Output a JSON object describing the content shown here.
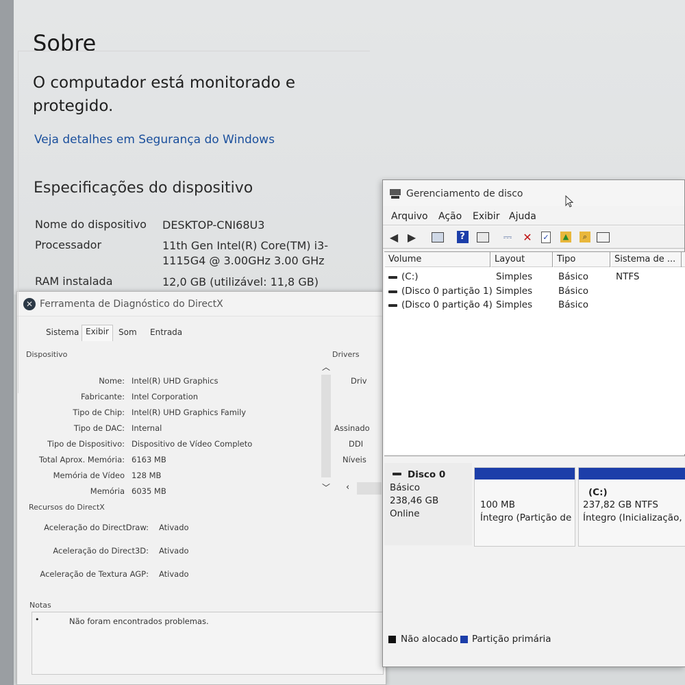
{
  "settings": {
    "title": "Sobre",
    "status": "O computador está monitorado e protegido.",
    "security_link": "Veja detalhes em Segurança do Windows",
    "specs_title": "Especificações do dispositivo",
    "rows": [
      {
        "label": "Nome do dispositivo",
        "value": "DESKTOP-CNI68U3"
      },
      {
        "label": "Processador",
        "value": "11th Gen Intel(R) Core(TM) i3-1115G4 @ 3.00GHz   3.00 GHz"
      },
      {
        "label": "RAM instalada",
        "value": "12,0 GB (utilizável: 11,8 GB)"
      }
    ]
  },
  "directx": {
    "title": "Ferramenta de Diagnóstico do DirectX",
    "tabs": [
      "Sistema",
      "Exibir",
      "Som",
      "Entrada"
    ],
    "active_tab": "Exibir",
    "device_group": "Dispositivo",
    "drivers_group": "Drivers",
    "device_rows": [
      {
        "label": "Nome:",
        "value": "Intel(R) UHD Graphics"
      },
      {
        "label": "Fabricante:",
        "value": "Intel Corporation"
      },
      {
        "label": "Tipo de Chip:",
        "value": "Intel(R) UHD Graphics Family"
      },
      {
        "label": "Tipo de DAC:",
        "value": "Internal"
      },
      {
        "label": "Tipo de Dispositivo:",
        "value": "Dispositivo de Vídeo Completo"
      },
      {
        "label": "Total Aprox. Memória:",
        "value": "6163 MB"
      },
      {
        "label": "Memória de Vídeo",
        "value": "128 MB"
      },
      {
        "label": "Memória",
        "value": "6035 MB"
      }
    ],
    "drivers_partial": [
      "Driv",
      "Assinado",
      "DDI",
      "Níveis"
    ],
    "resources_group": "Recursos do DirectX",
    "resources": [
      {
        "label": "Aceleração do DirectDraw:",
        "value": "Ativado"
      },
      {
        "label": "Aceleração do Direct3D:",
        "value": "Ativado"
      },
      {
        "label": "Aceleração de Textura AGP:",
        "value": "Ativado"
      }
    ],
    "notes_group": "Notas",
    "notes": [
      "Não foram encontrados problemas."
    ]
  },
  "disk": {
    "title": "Gerenciamento de disco",
    "menu": [
      "Arquivo",
      "Ação",
      "Exibir",
      "Ajuda"
    ],
    "columns": [
      "Volume",
      "Layout",
      "Tipo",
      "Sistema de ..."
    ],
    "volumes": [
      {
        "volume": "(C:)",
        "layout": "Simples",
        "type": "Básico",
        "fs": "NTFS"
      },
      {
        "volume": "(Disco 0 partição 1)",
        "layout": "Simples",
        "type": "Básico",
        "fs": ""
      },
      {
        "volume": "(Disco 0 partição 4)",
        "layout": "Simples",
        "type": "Básico",
        "fs": ""
      }
    ],
    "disk0": {
      "name": "Disco 0",
      "kind": "Básico",
      "size": "238,46 GB",
      "state": "Online"
    },
    "partitions": [
      {
        "name": "",
        "size": "100 MB",
        "status": "Íntegro (Partição de"
      },
      {
        "name": "(C:)",
        "size": "237,82 GB NTFS",
        "status": "Íntegro (Inicialização, Ar"
      }
    ],
    "legend": [
      {
        "label": "Não alocado",
        "color": "#111111"
      },
      {
        "label": "Partição primária",
        "color": "#1c3ea9"
      }
    ]
  }
}
